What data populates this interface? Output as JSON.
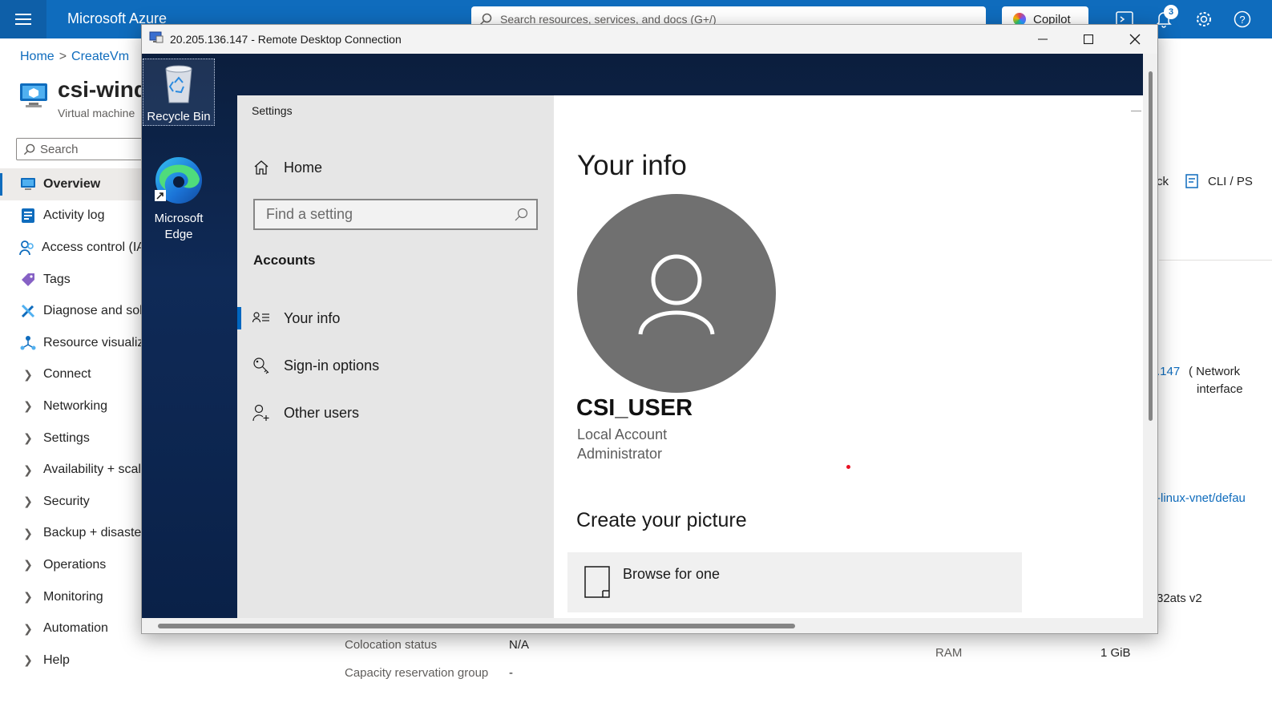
{
  "azure": {
    "brand": "Microsoft Azure",
    "search_placeholder": "Search resources, services, and docs (G+/)",
    "copilot_label": "Copilot",
    "notification_count": "3",
    "breadcrumb": [
      "Home",
      "CreateVm"
    ],
    "vm_title": "csi-wind",
    "vm_subtitle": "Virtual machine",
    "sidebar_search": "Search",
    "nav_items": [
      {
        "label": "Overview",
        "icon": "monitor-icon",
        "active": true
      },
      {
        "label": "Activity log",
        "icon": "activity-log-icon"
      },
      {
        "label": "Access control (IA",
        "icon": "people-icon"
      },
      {
        "label": "Tags",
        "icon": "tag-icon"
      },
      {
        "label": "Diagnose and sol",
        "icon": "wrench-icon"
      },
      {
        "label": "Resource visualiz",
        "icon": "network-icon"
      },
      {
        "label": "Connect",
        "chevron": true
      },
      {
        "label": "Networking",
        "chevron": true
      },
      {
        "label": "Settings",
        "chevron": true
      },
      {
        "label": "Availability + scal",
        "chevron": true
      },
      {
        "label": "Security",
        "chevron": true
      },
      {
        "label": "Backup + disaste",
        "chevron": true
      },
      {
        "label": "Operations",
        "chevron": true
      },
      {
        "label": "Monitoring",
        "chevron": true
      },
      {
        "label": "Automation",
        "chevron": true
      },
      {
        "label": "Help",
        "chevron": true
      }
    ],
    "toolbar_partial": "ck",
    "cli_label": "CLI / PS",
    "ip_partial": ".147",
    "network_interface": "( Network",
    "network_interface2": "interface",
    "vnet_link": "-linux-vnet/defau",
    "size_partial": "32ats v2",
    "colocation_label": "Colocation status",
    "colocation_value": "N/A",
    "capacity_label": "Capacity reservation group",
    "capacity_value": "-",
    "ram_label": "RAM",
    "ram_value": "1 GiB"
  },
  "rdp": {
    "title": "20.205.136.147 - Remote Desktop Connection",
    "desktop_icons": [
      {
        "label": "Recycle Bin"
      },
      {
        "label": "Microsoft Edge"
      }
    ]
  },
  "settings": {
    "app_title": "Settings",
    "home": "Home",
    "find_placeholder": "Find a setting",
    "section": "Accounts",
    "nav": [
      {
        "label": "Your info",
        "icon": "person-list-icon",
        "active": true
      },
      {
        "label": "Sign-in options",
        "icon": "key-icon"
      },
      {
        "label": "Other users",
        "icon": "person-add-icon"
      }
    ],
    "page_title": "Your info",
    "user_name": "CSI_USER",
    "account_type": "Local Account",
    "account_role": "Administrator",
    "create_picture": "Create your picture",
    "browse_label": "Browse for one"
  },
  "colors": {
    "azure_blue": "#0f6cbd",
    "desktop_bg": "#0f2a57",
    "settings_accent": "#0067c0",
    "avatar_gray": "#707070"
  }
}
